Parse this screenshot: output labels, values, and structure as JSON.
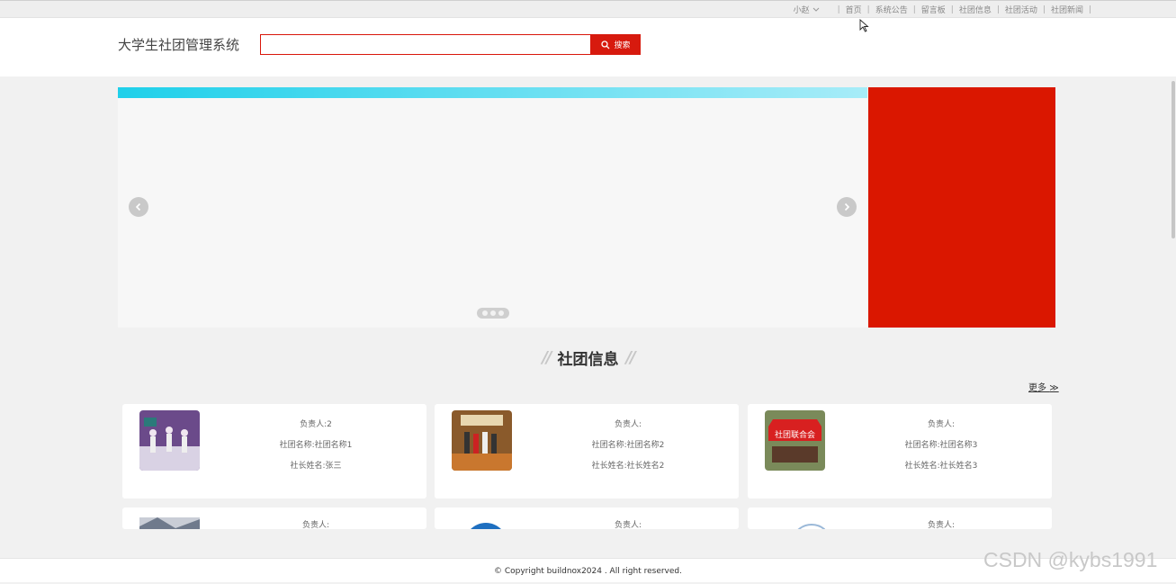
{
  "topbar": {
    "user": "小赵",
    "nav": [
      "首页",
      "系统公告",
      "留言板",
      "社团信息",
      "社团活动",
      "社团新闻"
    ]
  },
  "header": {
    "site_title": "大学生社团管理系统",
    "search_placeholder": "",
    "search_button": "搜索"
  },
  "section": {
    "title": "社团信息",
    "more": "更多"
  },
  "cards": [
    {
      "leader": "负责人:2",
      "club_name": "社团名称:社团名称1",
      "president": "社长姓名:张三"
    },
    {
      "leader": "负责人:",
      "club_name": "社团名称:社团名称2",
      "president": "社长姓名:社长姓名2"
    },
    {
      "leader": "负责人:",
      "club_name": "社团名称:社团名称3",
      "president": "社长姓名:社长姓名3"
    }
  ],
  "cards_row2": [
    {
      "leader": "负责人:"
    },
    {
      "leader": "负责人:"
    },
    {
      "leader": "负责人:"
    }
  ],
  "card3_banner_text": "社团联合会",
  "footer": {
    "copyright": "© Copyright buildnox2024 . All right reserved."
  },
  "watermark": "CSDN @kybs1991",
  "colors": {
    "accent": "#d71a0e",
    "banner_strip": "#1fd0ea",
    "side_block": "#da1700"
  }
}
